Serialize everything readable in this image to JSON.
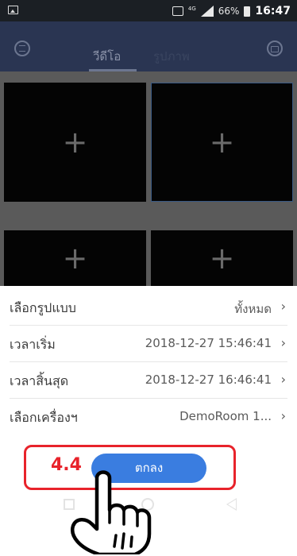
{
  "status_bar": {
    "battery": "66%",
    "time": "16:47",
    "network": "4G"
  },
  "header": {
    "tabs": [
      {
        "label": "วีดีโอ"
      },
      {
        "label": "รูปภาพ"
      }
    ]
  },
  "grid": {
    "cells": [
      "+",
      "+",
      "+",
      "+"
    ]
  },
  "filter_sheet": {
    "rows": [
      {
        "label": "เลือกรูปแบบ",
        "value": "ทั้งหมด"
      },
      {
        "label": "เวลาเริ่ม",
        "value": "2018-12-27 15:46:41"
      },
      {
        "label": "เวลาสิ้นสุด",
        "value": "2018-12-27 16:46:41"
      },
      {
        "label": "เลือกเครื่องฯ",
        "value": "DemoRoom 1..."
      }
    ],
    "confirm_label": "ตกลง"
  },
  "annotation": {
    "step": "4.4"
  },
  "colors": {
    "accent": "#3a7de0",
    "highlight": "#e8232b",
    "header": "#2a3552"
  }
}
